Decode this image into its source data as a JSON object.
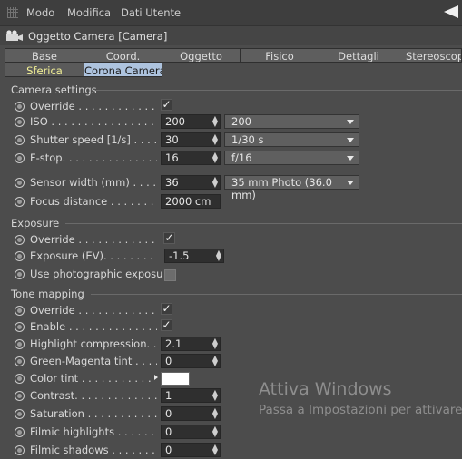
{
  "menubar": {
    "items": [
      "Modo",
      "Modifica",
      "Dati Utente"
    ]
  },
  "header": {
    "title": "Oggetto Camera [Camera]"
  },
  "tabs": {
    "row1": [
      "Base",
      "Coord.",
      "Oggetto",
      "Fisico",
      "Dettagli",
      "Stereoscopic"
    ],
    "row2": [
      "Sferica",
      "Corona Camera"
    ]
  },
  "camera_settings": {
    "title": "Camera settings",
    "override": {
      "label": "Override . . . . . . . . . . . . . . .",
      "checked": true
    },
    "iso": {
      "label": "ISO . . . . . . . . . . . . . . . . . . .",
      "value": "200",
      "preset": "200"
    },
    "shutter": {
      "label": "Shutter speed [1/s] . . . . . .",
      "value": "30",
      "preset": "1/30 s"
    },
    "fstop": {
      "label": "F-stop. . . . . . . . . . . . . . . . .",
      "value": "16",
      "preset": "f/16"
    },
    "sensor": {
      "label": "Sensor width (mm) . . . . . . .",
      "value": "36",
      "preset": "35 mm Photo (36.0 mm)"
    },
    "focus": {
      "label": "Focus distance . . . . . . . . .",
      "value": "2000 cm"
    }
  },
  "exposure": {
    "title": "Exposure",
    "override": {
      "label": "Override . . . . . . . . . . . . . . .",
      "checked": true
    },
    "ev": {
      "label": "Exposure (EV). . . . . . . . . . .",
      "value": "-1.5"
    },
    "photographic": {
      "label": "Use photographic exposure",
      "checked": false
    }
  },
  "tone_mapping": {
    "title": "Tone mapping",
    "override": {
      "label": "Override . . . . . . . . . . . . . . .",
      "checked": true
    },
    "enable": {
      "label": "Enable . . . . . . . . . . . . . . . .",
      "checked": true
    },
    "highlight": {
      "label": "Highlight compression. . . .",
      "value": "2.1"
    },
    "green_magenta": {
      "label": "Green-Magenta tint . . . . . .",
      "value": "0"
    },
    "color_tint": {
      "label": "Color tint . . . . . . . . . . . . .",
      "color": "#ffffff"
    },
    "contrast": {
      "label": "Contrast. . . . . . . . . . . . . . .",
      "value": "1"
    },
    "saturation": {
      "label": "Saturation . . . . . . . . . . . . .",
      "value": "0"
    },
    "filmic_highlights": {
      "label": "Filmic highlights . . . . . . . .",
      "value": "0"
    },
    "filmic_shadows": {
      "label": "Filmic shadows . . . . . . . . .",
      "value": "0"
    }
  },
  "watermark": {
    "title": "Attiva Windows",
    "subtitle": "Passa a Impostazioni per attivare W"
  }
}
